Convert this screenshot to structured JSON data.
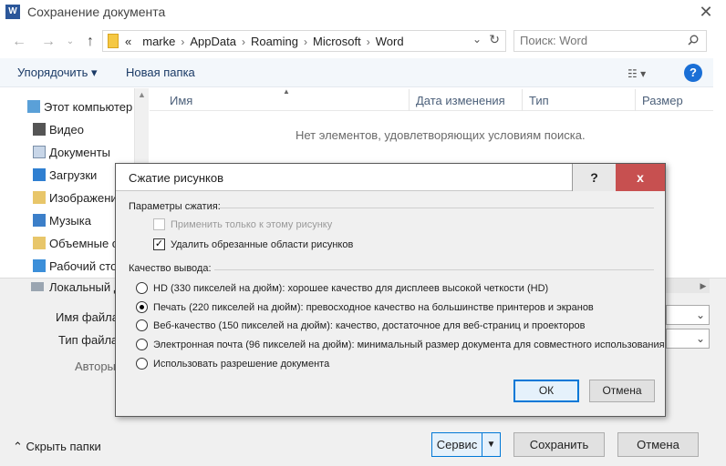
{
  "window": {
    "title": "Сохранение документа",
    "app_icon": "W"
  },
  "address": {
    "crumbs": [
      "«",
      "marke",
      "AppData",
      "Roaming",
      "Microsoft",
      "Word"
    ]
  },
  "search": {
    "placeholder": "Поиск: Word"
  },
  "toolbar": {
    "organize": "Упорядочить ▾",
    "new_folder": "Новая папка"
  },
  "nav": {
    "items": [
      "Этот компьютер",
      "Видео",
      "Документы",
      "Загрузки",
      "Изображения",
      "Музыка",
      "Объемные о",
      "Рабочий сто"
    ],
    "local_disk": "Локальный д"
  },
  "columns": [
    "Имя",
    "Дата изменения",
    "Тип",
    "Размер"
  ],
  "empty_message": "Нет элементов, удовлетворяющих условиям поиска.",
  "form": {
    "filename_label": "Имя файла",
    "filetype_label": "Тип файла",
    "authors_label": "Авторы"
  },
  "footer": {
    "hide_folders": "Скрыть папки",
    "service": "Сервис",
    "save": "Сохранить",
    "cancel": "Отмена"
  },
  "compress": {
    "title": "Сжатие рисунков",
    "help": "?",
    "close": "x",
    "params_label": "Параметры сжатия:",
    "apply_only": "Применить только к этому рисунку",
    "delete_cropped": "Удалить обрезанные области рисунков",
    "quality_label": "Качество вывода:",
    "options": [
      "HD (330 пикселей на дюйм): хорошее качество для дисплеев высокой четкости (HD)",
      "Печать (220 пикселей на дюйм): превосходное качество на большинстве принтеров и экранов",
      "Веб-качество (150 пикселей на дюйм): качество, достаточное для веб-страниц и проекторов",
      "Электронная почта (96 пикселей на дюйм): минимальный размер документа для совместного использования",
      "Использовать разрешение документа"
    ],
    "ok": "ОК",
    "cancel": "Отмена"
  }
}
